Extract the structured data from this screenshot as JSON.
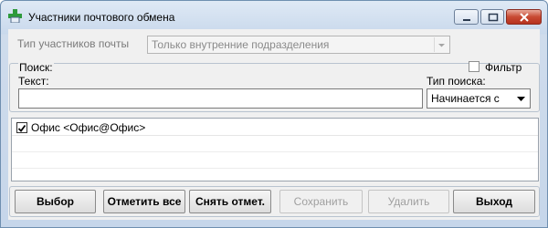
{
  "window": {
    "title": "Участники почтового обмена"
  },
  "participants_type": {
    "label": "Тип участников почты",
    "value": "Только внутренние подразделения"
  },
  "search": {
    "caption": "Поиск:",
    "filter_label": "Фильтр",
    "filter_checked": false,
    "text_label": "Текст:",
    "text_value": "",
    "type_label": "Тип поиска:",
    "type_value": "Начинается с"
  },
  "list": {
    "items": [
      {
        "label": "Офис <Офис@Офис>",
        "checked": true
      }
    ]
  },
  "buttons": {
    "select": "Выбор",
    "mark_all": "Отметить все",
    "unmark": "Снять отмет.",
    "save": "Сохранить",
    "delete": "Удалить",
    "exit": "Выход"
  },
  "icons": {
    "app": "green-cross-envelope-icon",
    "minimize": "minimize-icon",
    "maximize": "maximize-icon",
    "close": "close-icon"
  }
}
